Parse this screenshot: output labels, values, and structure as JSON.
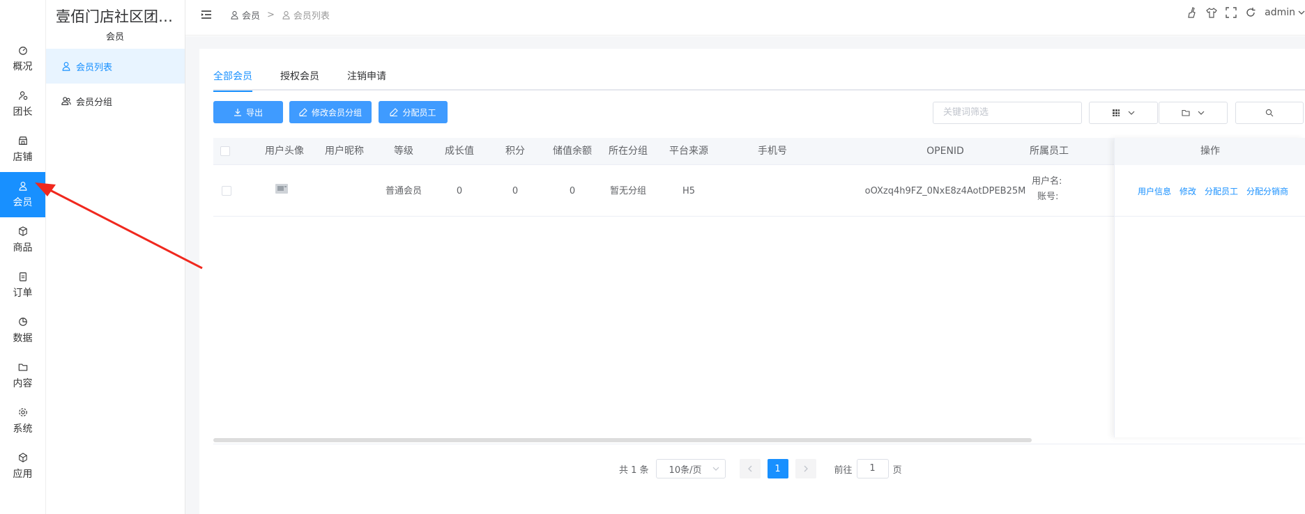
{
  "app": {
    "title": "壹佰门店社区团…",
    "section": "会员"
  },
  "rail": [
    {
      "label": "概况",
      "icon": "dashboard-icon"
    },
    {
      "label": "团长",
      "icon": "leader-icon"
    },
    {
      "label": "店铺",
      "icon": "store-icon"
    },
    {
      "label": "会员",
      "icon": "user-icon",
      "active": true
    },
    {
      "label": "商品",
      "icon": "box-icon"
    },
    {
      "label": "订单",
      "icon": "clipboard-icon"
    },
    {
      "label": "数据",
      "icon": "pie-icon"
    },
    {
      "label": "内容",
      "icon": "folder-icon"
    },
    {
      "label": "系统",
      "icon": "gear-icon"
    },
    {
      "label": "应用",
      "icon": "cube-icon"
    }
  ],
  "submenu": [
    {
      "label": "会员列表",
      "active": true
    },
    {
      "label": "会员分组"
    }
  ],
  "header": {
    "breadcrumb": [
      "会员",
      "会员列表"
    ],
    "breadcrumb_sep": ">",
    "user": "admin"
  },
  "tabs": [
    "全部会员",
    "授权会员",
    "注销申请"
  ],
  "buttons": {
    "export": "导出",
    "edit_group": "修改会员分组",
    "assign_staff": "分配员工"
  },
  "search": {
    "placeholder": "关键词筛选"
  },
  "table": {
    "columns": [
      "用户头像",
      "用户昵称",
      "等级",
      "成长值",
      "积分",
      "储值余额",
      "所在分组",
      "平台来源",
      "手机号",
      "OPENID",
      "所属员工",
      "操作"
    ],
    "rows": [
      {
        "nickname": "",
        "level": "普通会员",
        "growth": "0",
        "points": "0",
        "balance": "0",
        "group": "暂无分组",
        "source": "H5",
        "phone": "",
        "openid": "oOXzq4h9FZ_0NxE8z4AotDPEB25M",
        "staff_username_label": "用户名:",
        "staff_account_label": "账号:",
        "actions": [
          "用户信息",
          "修改",
          "分配员工",
          "分配分销商"
        ]
      }
    ]
  },
  "pagination": {
    "total": "共 1 条",
    "page_size": "10条/页",
    "current": "1",
    "goto_label": "前往",
    "goto_value": "1",
    "page_unit": "页"
  },
  "colors": {
    "primary": "#1890ff",
    "button": "#3f9bff",
    "arrow": "#f0281e"
  }
}
